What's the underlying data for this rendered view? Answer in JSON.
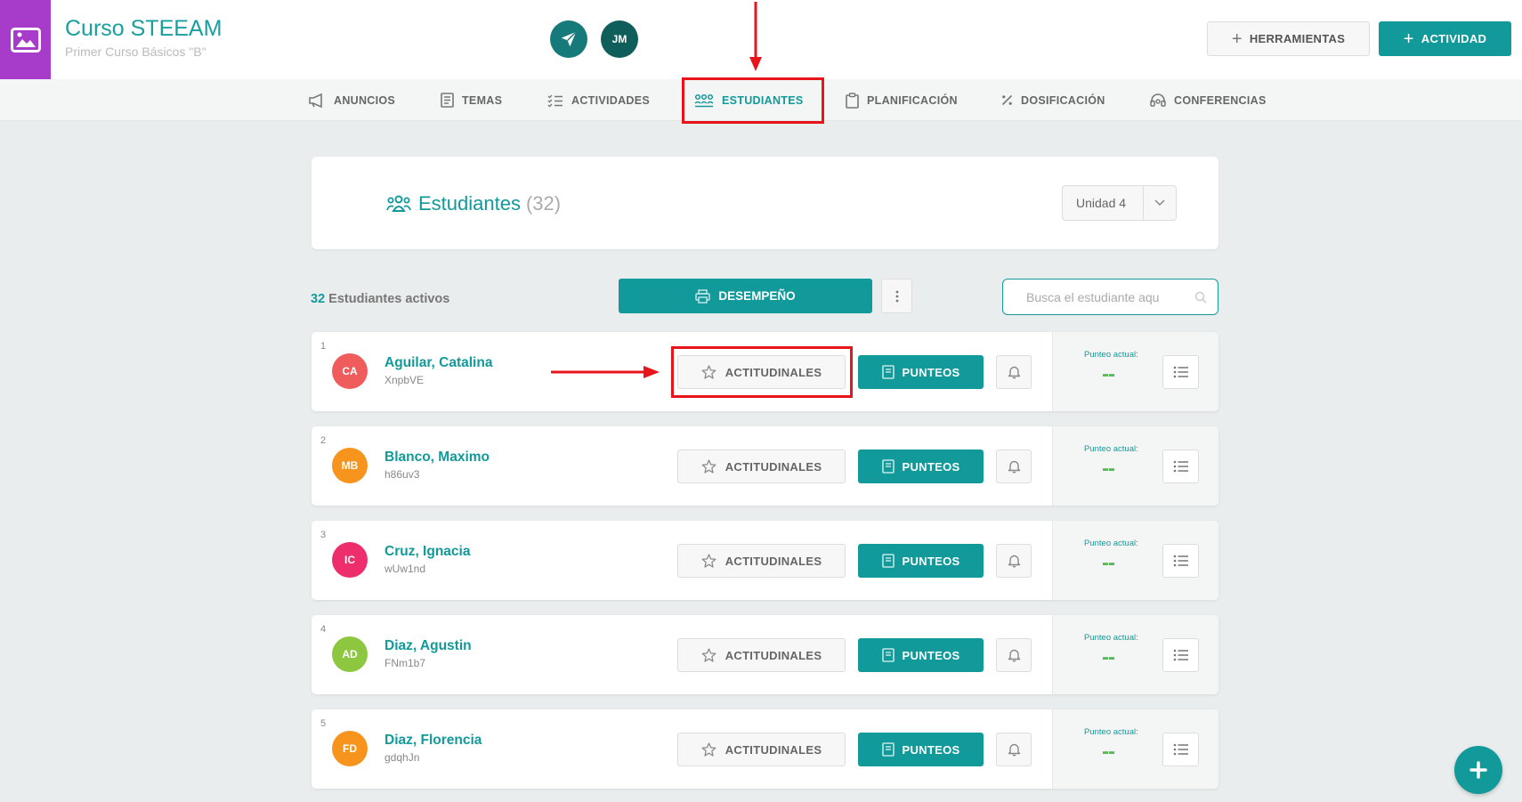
{
  "course": {
    "title": "Curso STEEAM",
    "subtitle": "Primer Curso Básicos \"B\"",
    "image_color": "#a63cc9"
  },
  "header": {
    "avatar_initials": "JM",
    "tools_label": "HERRAMIENTAS",
    "activity_label": "ACTIVIDAD"
  },
  "nav": {
    "items": [
      {
        "label": "ANUNCIOS",
        "icon": "megaphone-icon"
      },
      {
        "label": "TEMAS",
        "icon": "document-icon"
      },
      {
        "label": "ACTIVIDADES",
        "icon": "checklist-icon"
      },
      {
        "label": "ESTUDIANTES",
        "icon": "students-icon",
        "active": true
      },
      {
        "label": "PLANIFICACIÓN",
        "icon": "clipboard-icon"
      },
      {
        "label": "DOSIFICACIÓN",
        "icon": "percent-icon"
      },
      {
        "label": "CONFERENCIAS",
        "icon": "headset-icon"
      }
    ]
  },
  "students_header": {
    "title": "Estudiantes",
    "count": "(32)",
    "unit_selected": "Unidad 4"
  },
  "toolbar": {
    "active_count": "32",
    "active_label": "Estudiantes activos",
    "performance_label": "DESEMPEÑO",
    "search_placeholder": "Busca el estudiante aqu"
  },
  "row_labels": {
    "attitudinal": "ACTITUDINALES",
    "scores": "PUNTEOS",
    "current_score_label": "Punteo actual:"
  },
  "students": [
    {
      "num": "1",
      "initials": "CA",
      "name": "Aguilar, Catalina",
      "code": "XnpbVE",
      "score": "--",
      "color": "#f05b5b"
    },
    {
      "num": "2",
      "initials": "MB",
      "name": "Blanco, Maximo",
      "code": "h86uv3",
      "score": "--",
      "color": "#f7941d"
    },
    {
      "num": "3",
      "initials": "IC",
      "name": "Cruz, Ignacia",
      "code": "wUw1nd",
      "score": "--",
      "color": "#ee2d6d"
    },
    {
      "num": "4",
      "initials": "AD",
      "name": "Diaz, Agustin",
      "code": "FNm1b7",
      "score": "--",
      "color": "#8dc63f"
    },
    {
      "num": "5",
      "initials": "FD",
      "name": "Diaz, Florencia",
      "code": "gdqhJn",
      "score": "--",
      "color": "#f7941d"
    }
  ],
  "colors": {
    "accent": "#12999a",
    "highlight": "#e8141b",
    "score": "#5cb85c"
  }
}
